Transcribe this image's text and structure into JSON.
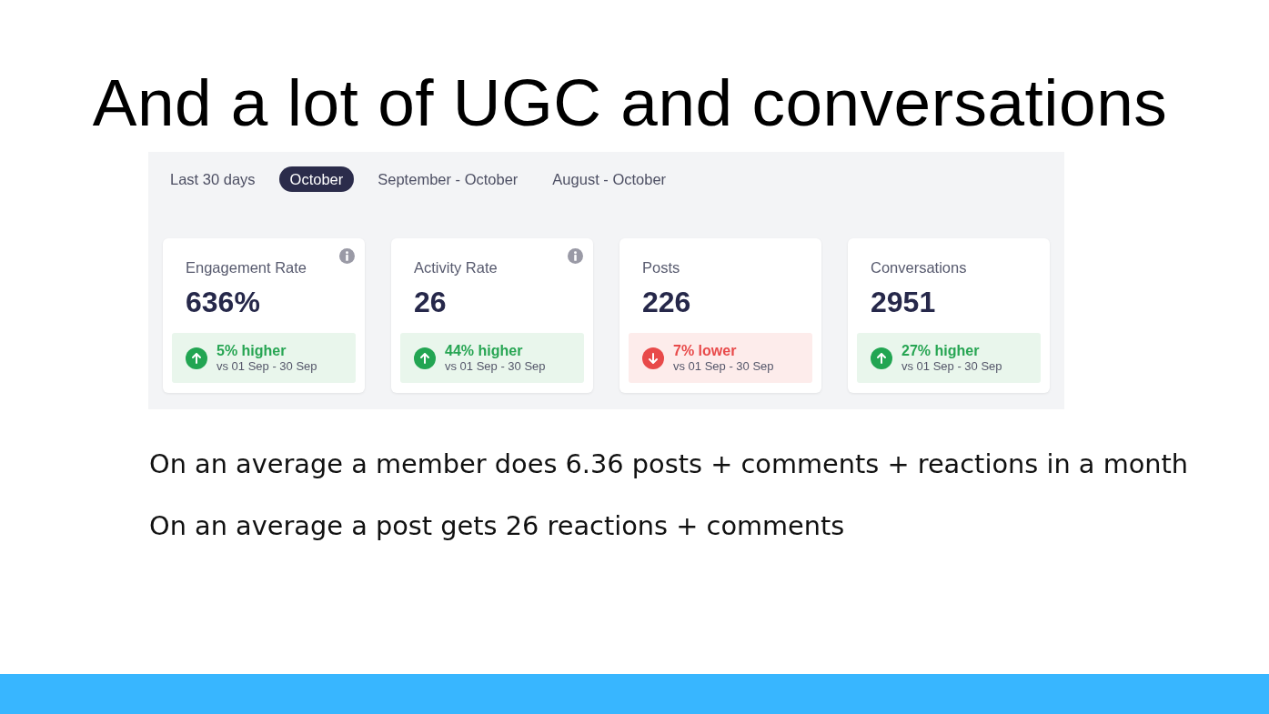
{
  "title": "And a lot of UGC and conversations",
  "dashboard": {
    "tabs": [
      {
        "label": "Last 30 days",
        "selected": false
      },
      {
        "label": "October",
        "selected": true
      },
      {
        "label": "September - October",
        "selected": false
      },
      {
        "label": "August - October",
        "selected": false
      }
    ],
    "cards": [
      {
        "label": "Engagement Rate",
        "info": true,
        "value": "636%",
        "change": {
          "kind": "up",
          "text": "5% higher",
          "comparison": "vs 01 Sep - 30 Sep"
        }
      },
      {
        "label": "Activity Rate",
        "info": true,
        "value": "26",
        "change": {
          "kind": "up",
          "text": "44% higher",
          "comparison": "vs 01 Sep - 30 Sep"
        }
      },
      {
        "label": "Posts",
        "info": false,
        "value": "226",
        "change": {
          "kind": "down",
          "text": "7% lower",
          "comparison": "vs 01 Sep - 30 Sep"
        }
      },
      {
        "label": "Conversations",
        "info": false,
        "value": "2951",
        "change": {
          "kind": "up",
          "text": "27% higher",
          "comparison": "vs 01 Sep - 30 Sep"
        }
      }
    ]
  },
  "notes": [
    "On an average a member does 6.36 posts + comments + reactions in a month",
    "On an average a post gets 26 reactions + comments"
  ]
}
